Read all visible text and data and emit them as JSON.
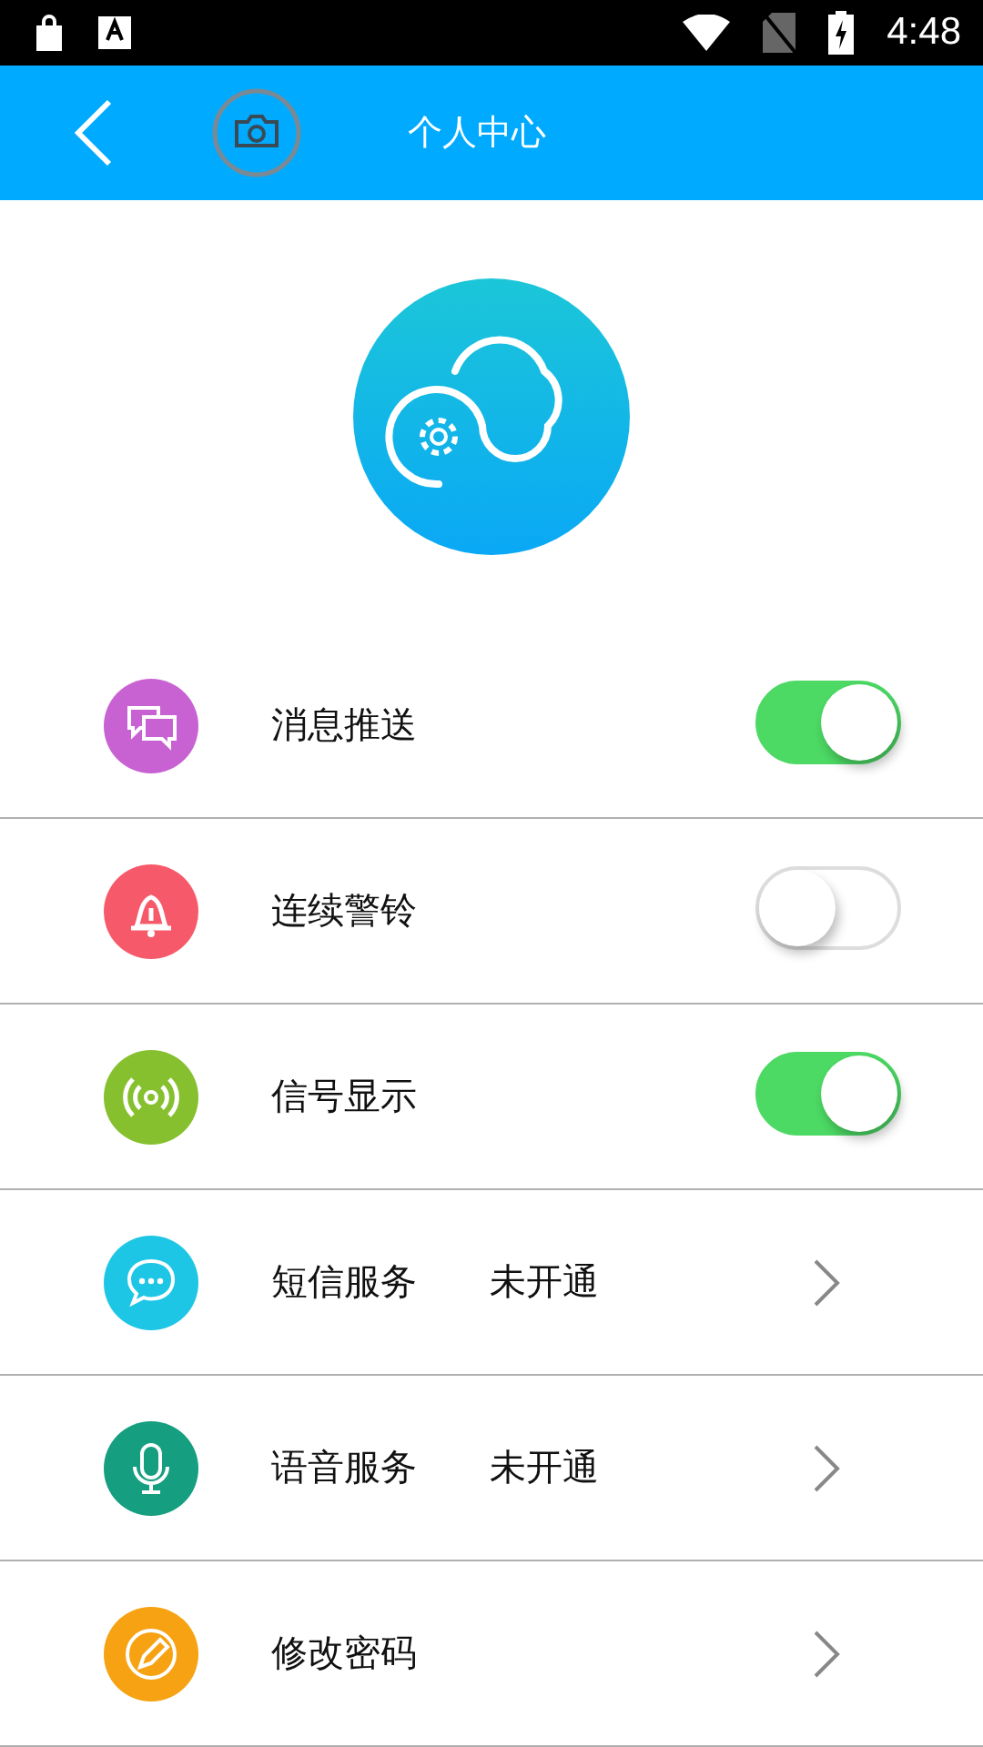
{
  "status_bar": {
    "time": "4:48"
  },
  "header": {
    "title": "个人中心"
  },
  "settings": [
    {
      "label": "消息推送",
      "kind": "toggle",
      "on": true,
      "color": "#c862d2"
    },
    {
      "label": "连续警铃",
      "kind": "toggle",
      "on": false,
      "color": "#f65a6a"
    },
    {
      "label": "信号显示",
      "kind": "toggle",
      "on": true,
      "color": "#86c02e"
    },
    {
      "label": "短信服务",
      "kind": "link",
      "value": "未开通",
      "color": "#1ec6e6"
    },
    {
      "label": "语音服务",
      "kind": "link",
      "value": "未开通",
      "color": "#159e80"
    },
    {
      "label": "修改密码",
      "kind": "link",
      "color": "#f6a212"
    }
  ]
}
